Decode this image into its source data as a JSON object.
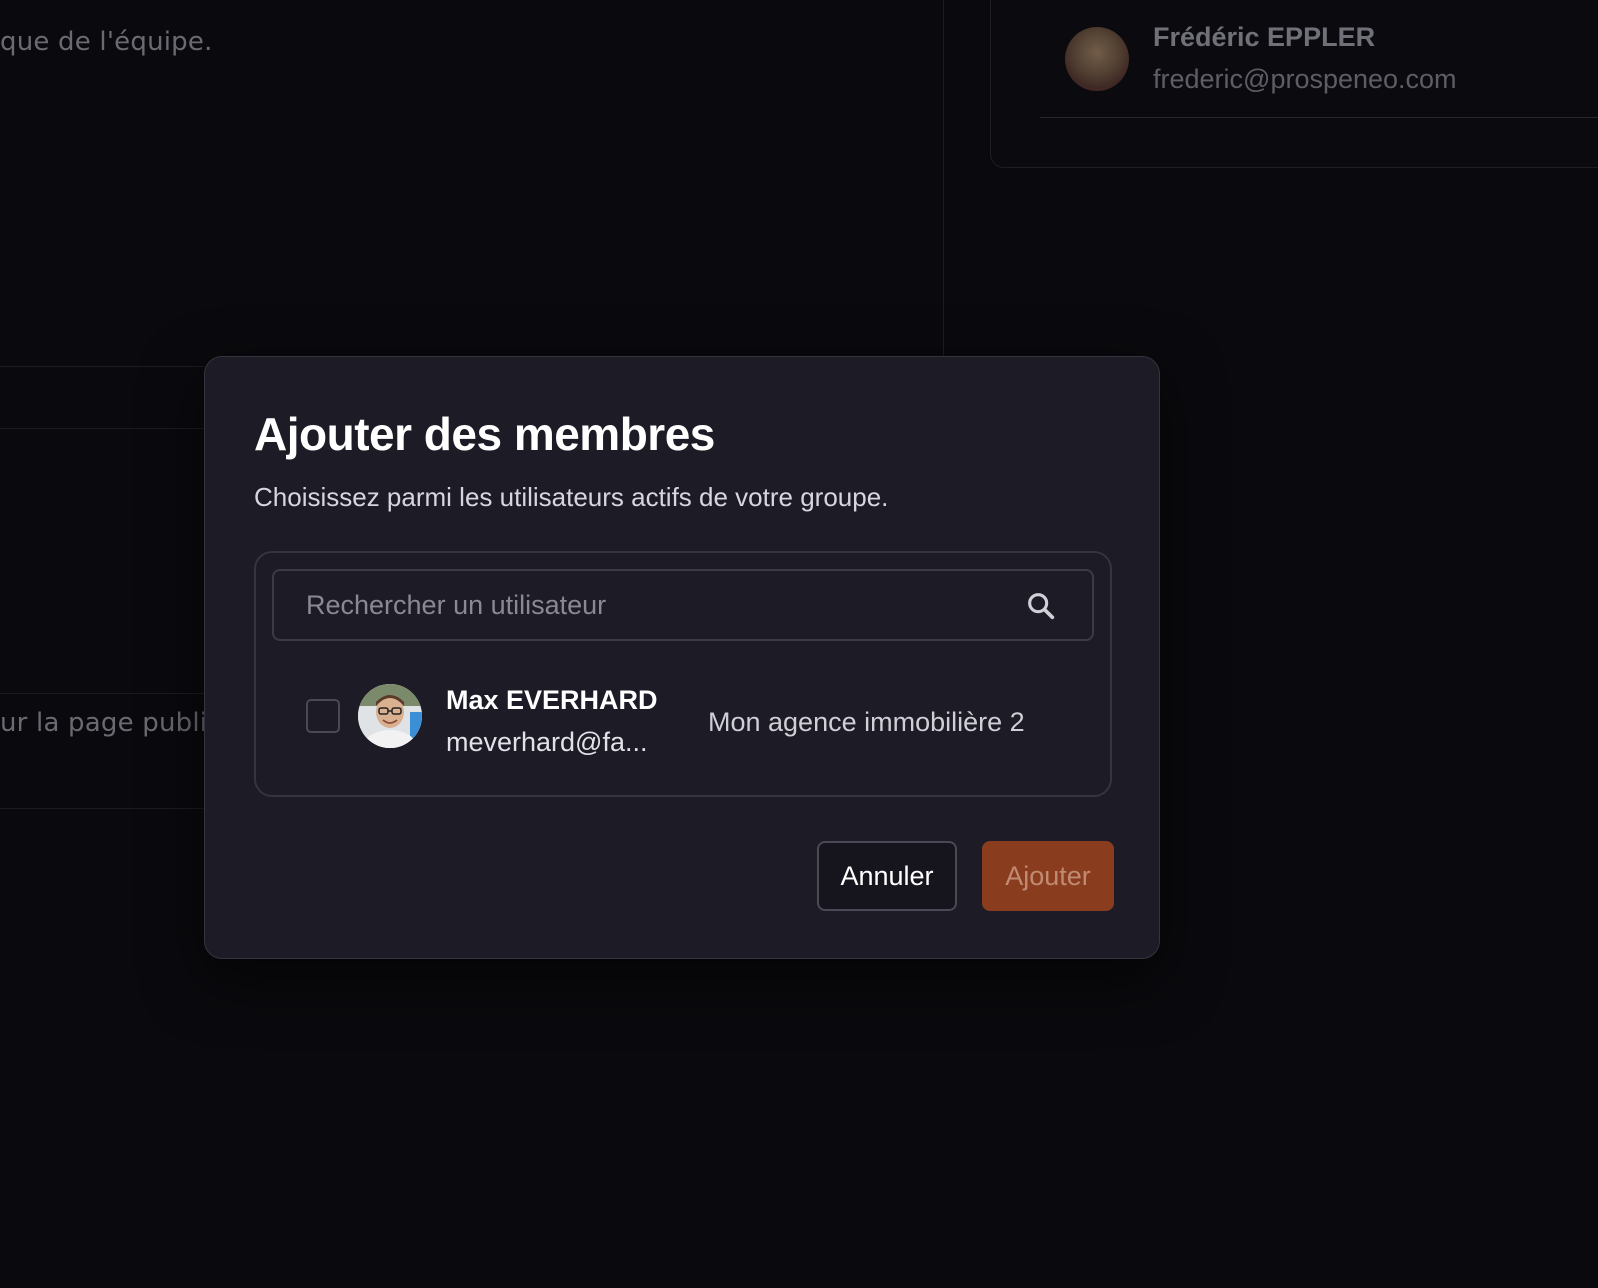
{
  "background": {
    "text_top_left": "que de l'équipe.",
    "text_mid_left": "ur la page publi",
    "member_card": {
      "name": "Frédéric EPPLER",
      "email": "frederic@prospeneo.com"
    }
  },
  "modal": {
    "title": "Ajouter des membres",
    "subtitle": "Choisissez parmi les utilisateurs actifs de votre groupe.",
    "search": {
      "placeholder": "Rechercher un utilisateur",
      "value": "",
      "icon": "search-icon"
    },
    "users": [
      {
        "name": "Max EVERHARD",
        "email": "meverhard@fa...",
        "group": "Mon agence immobilière 2",
        "checked": false
      }
    ],
    "buttons": {
      "cancel_label": "Annuler",
      "add_label": "Ajouter"
    }
  },
  "colors": {
    "page_background": "#0a0a0e",
    "modal_background": "#1c1b26",
    "accent": "#8a3c1f",
    "accent_text_disabled": "#c08b72"
  }
}
